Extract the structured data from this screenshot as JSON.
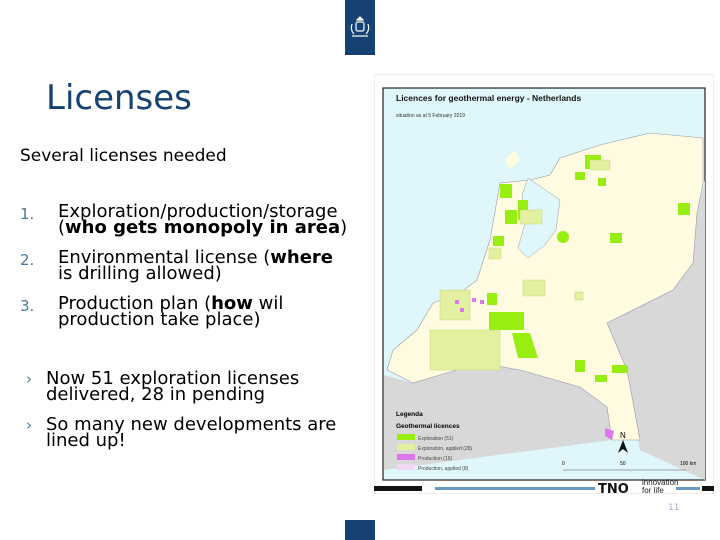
{
  "slide": {
    "title": "Licenses",
    "subtitle": "Several licenses needed",
    "numbered": [
      {
        "num": "1.",
        "line1": "Exploration/production/storage",
        "line2_pre": "(",
        "line2_bold": "who gets monopoly in area",
        "line2_post": ")"
      },
      {
        "num": "2.",
        "line1_pre": "Environmental license (",
        "line1_bold": "where",
        "line2": "is drilling allowed)"
      },
      {
        "num": "3.",
        "line1_pre": "Production plan (",
        "line1_bold": "how",
        "line1_post": " wil",
        "line2": "production take place)"
      }
    ],
    "bullets": [
      {
        "marker": "›",
        "line1": "Now 51 exploration licenses",
        "line2": "delivered, 28 in pending"
      },
      {
        "marker": "›",
        "line1": "So many new developments are",
        "line2": "lined up!"
      }
    ],
    "page_number": "11"
  },
  "map": {
    "title": "Licences for geothermal energy - Netherlands",
    "situation": "situation as at 5 February 2019",
    "legend_title": "Legenda",
    "legend_subtitle": "Geothermal licences",
    "legend": [
      {
        "label": "Exploration  (51)",
        "color": "#99ee11"
      },
      {
        "label": "Exploration, applied  (28)",
        "color": "#e3f0a0"
      },
      {
        "label": "Production  (16)",
        "color": "#dd77ee"
      },
      {
        "label": "Production, applied  (8)",
        "color": "#f0d8f0"
      }
    ],
    "scale": [
      "0",
      "50",
      "100 km"
    ],
    "north": "N",
    "colors": {
      "land": "#fefbe0",
      "sea": "#dff7fb",
      "foreign": "#d8d8d8"
    }
  },
  "brand": {
    "name": "TNO",
    "tagline1": "innovation",
    "tagline2": "for life",
    "blue": "#154273"
  }
}
